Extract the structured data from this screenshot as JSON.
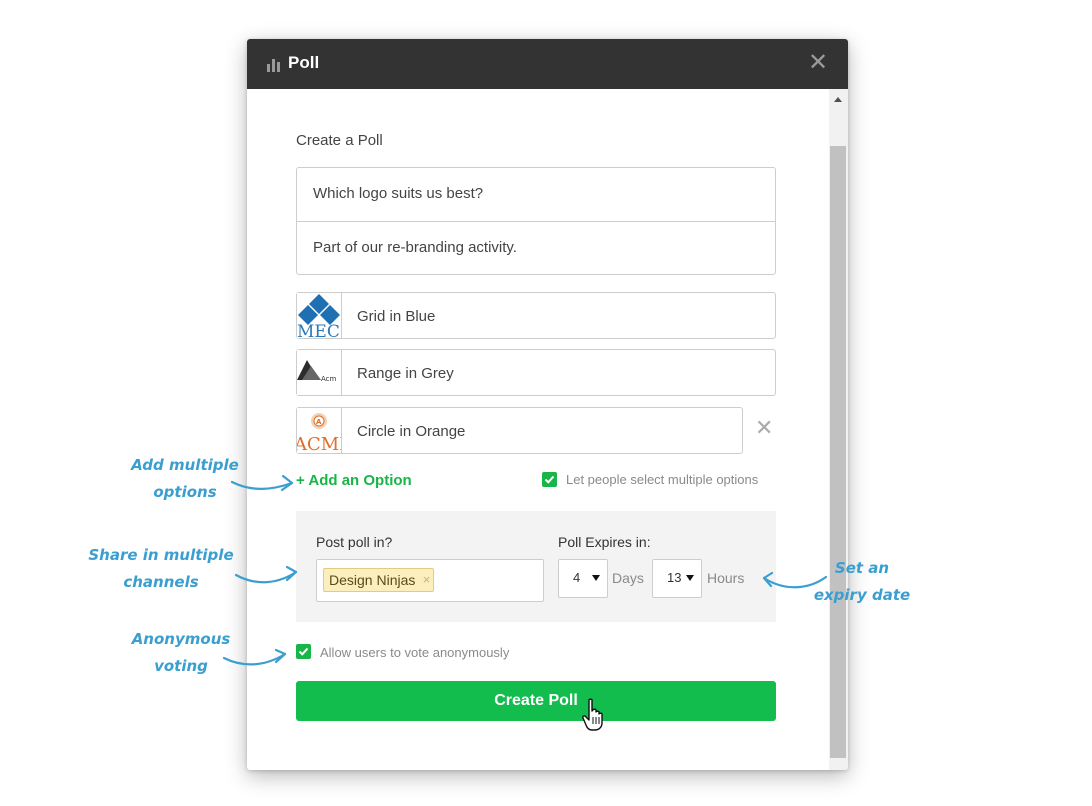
{
  "dialog": {
    "title": "Poll",
    "close_glyph": "✕",
    "icon": "bar-chart-icon"
  },
  "form": {
    "section_title": "Create a Poll",
    "question": "Which logo suits us best?",
    "description": "Part of our re-branding activity.",
    "options": [
      {
        "label": "Grid in Blue",
        "logo": "mec-logo"
      },
      {
        "label": "Range in Grey",
        "logo": "acme-range-logo"
      },
      {
        "label": "Circle in Orange",
        "logo": "acme-circle-logo"
      }
    ],
    "remove_glyph": "✕",
    "add_option": "+ Add an Option",
    "multi_select": {
      "label": "Let people select multiple options",
      "checked": true
    },
    "post_in_label": "Post poll in?",
    "channel_tag": "Design Ninjas",
    "tag_remove_glyph": "×",
    "expires_label": "Poll Expires in:",
    "days_value": "4",
    "days_unit": "Days",
    "hours_value": "13",
    "hours_unit": "Hours",
    "anonymous": {
      "label": "Allow users to vote anonymously",
      "checked": true
    },
    "submit": "Create Poll"
  },
  "annotations": {
    "add_multiple": [
      "Add multiple",
      "options"
    ],
    "share_channels": [
      "Share in multiple",
      "channels"
    ],
    "anonymous": [
      "Anonymous",
      "voting"
    ],
    "expiry": [
      "Set an",
      "expiry date"
    ]
  },
  "colors": {
    "accent_green": "#12bd4e",
    "titlebar": "#333333",
    "annotation_blue": "#3a9fd0",
    "tag_bg": "#fcefbe"
  }
}
